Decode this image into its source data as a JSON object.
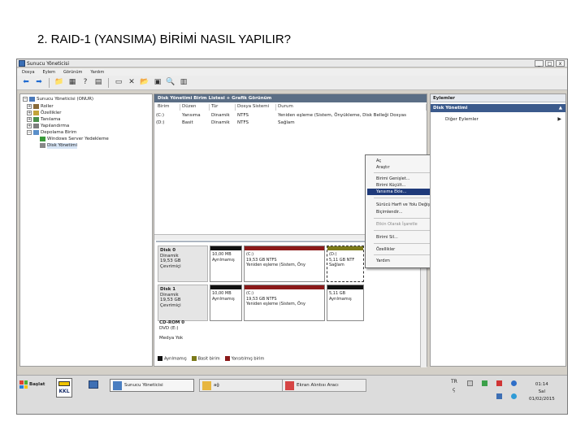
{
  "slide": {
    "title": "2. RAID-1 (YANSIMA) BİRİMİ NASIL YAPILIR?"
  },
  "window": {
    "title": "Sunucu Yöneticisi",
    "controls": {
      "minimize": "_",
      "maximize": "□",
      "close": "x"
    }
  },
  "menubar": {
    "items": [
      "Dosya",
      "Eylem",
      "Görünüm",
      "Yardım"
    ]
  },
  "tree": {
    "root": "Sunucu Yöneticisi (ONUR)",
    "items": [
      "Roller",
      "Özellikler",
      "Tanılama",
      "Yapılandırma",
      "Depolama Birim"
    ],
    "subitems": [
      "Windows Server Yedekleme",
      "Disk Yönetimi"
    ]
  },
  "center": {
    "header": "Disk Yönetimi   Birim Listesi + Grafik Görünüm",
    "columns": [
      "Birim",
      "Düzen",
      "Tür",
      "Dosya Sistemi",
      "Durum"
    ],
    "rows": [
      {
        "birim": "(C:)",
        "duzen": "Yansıma",
        "tur": "Dinamik",
        "fs": "NTFS",
        "durum": "Yeniden eşleme (Sistem, Önyükleme, Disk Belleği Dosyas"
      },
      {
        "birim": "(D:)",
        "duzen": "Basit",
        "tur": "Dinamik",
        "fs": "NTFS",
        "durum": "Sağlam"
      }
    ],
    "disks": [
      {
        "label": "Disk 0",
        "type": "Dinamik",
        "size": "19,53 GB",
        "status": "Çevrimiçi",
        "parts": [
          {
            "title": "",
            "l1": "10,00 MB",
            "l2": "Ayrılmamış"
          },
          {
            "title": "(C:)",
            "l1": "19,53 GB NTFS",
            "l2": "Yeniden eşleme (Sistem, Öny"
          },
          {
            "title": "(D:)",
            "l1": "5,11 GB NTF",
            "l2": "Sağlam"
          }
        ]
      },
      {
        "label": "Disk 1",
        "type": "Dinamik",
        "size": "19,53 GB",
        "status": "Çevrimiçi",
        "parts": [
          {
            "title": "",
            "l1": "10,00 MB",
            "l2": "Ayrılmamış"
          },
          {
            "title": "(C:)",
            "l1": "19,53 GB NTFS",
            "l2": "Yeniden eşleme (Sistem, Öny"
          },
          {
            "title": "",
            "l1": "5,11 GB",
            "l2": "Ayrılmamış"
          }
        ]
      }
    ],
    "cdrom": {
      "label": "CD-ROM 0",
      "drive": "DVD (E:)",
      "media": "Medya Yok"
    },
    "legend": [
      {
        "label": "Ayrılmamış",
        "color": "#111111"
      },
      {
        "label": "Basit birim",
        "color": "#7c7a1a"
      },
      {
        "label": "Yansıtılmış birim",
        "color": "#8b1a1a"
      }
    ]
  },
  "context_menu": {
    "items": [
      {
        "label": "Aç",
        "state": "normal"
      },
      {
        "label": "Araştır",
        "state": "normal"
      },
      {
        "label": "Birimi Genişlet...",
        "state": "normal"
      },
      {
        "label": "Birimi Küçült...",
        "state": "normal"
      },
      {
        "label": "Yansıma Ekle...",
        "state": "highlighted"
      },
      {
        "label": "Sürücü Harfi ve Yolu Değiştir...",
        "state": "normal"
      },
      {
        "label": "Biçimlendir...",
        "state": "normal"
      },
      {
        "label": "Etkin Olarak İşaretle",
        "state": "disabled"
      },
      {
        "label": "Birimi Sil...",
        "state": "normal"
      },
      {
        "label": "Özellikler",
        "state": "normal"
      },
      {
        "label": "Yardım",
        "state": "normal"
      }
    ]
  },
  "actions": {
    "header": "Eylemler",
    "section": "Disk Yönetimi",
    "item": "Diğer Eylemler"
  },
  "taskbar": {
    "start": "Başlat",
    "kkl": "KKL",
    "tasks": [
      "Sunucu Yöneticisi",
      "ağ",
      "Ekran Alıntısı Aracı"
    ],
    "lang": "TR",
    "lang_sub": "ç",
    "time": "01:14",
    "day": "Sal",
    "date": "01/02/2015"
  }
}
